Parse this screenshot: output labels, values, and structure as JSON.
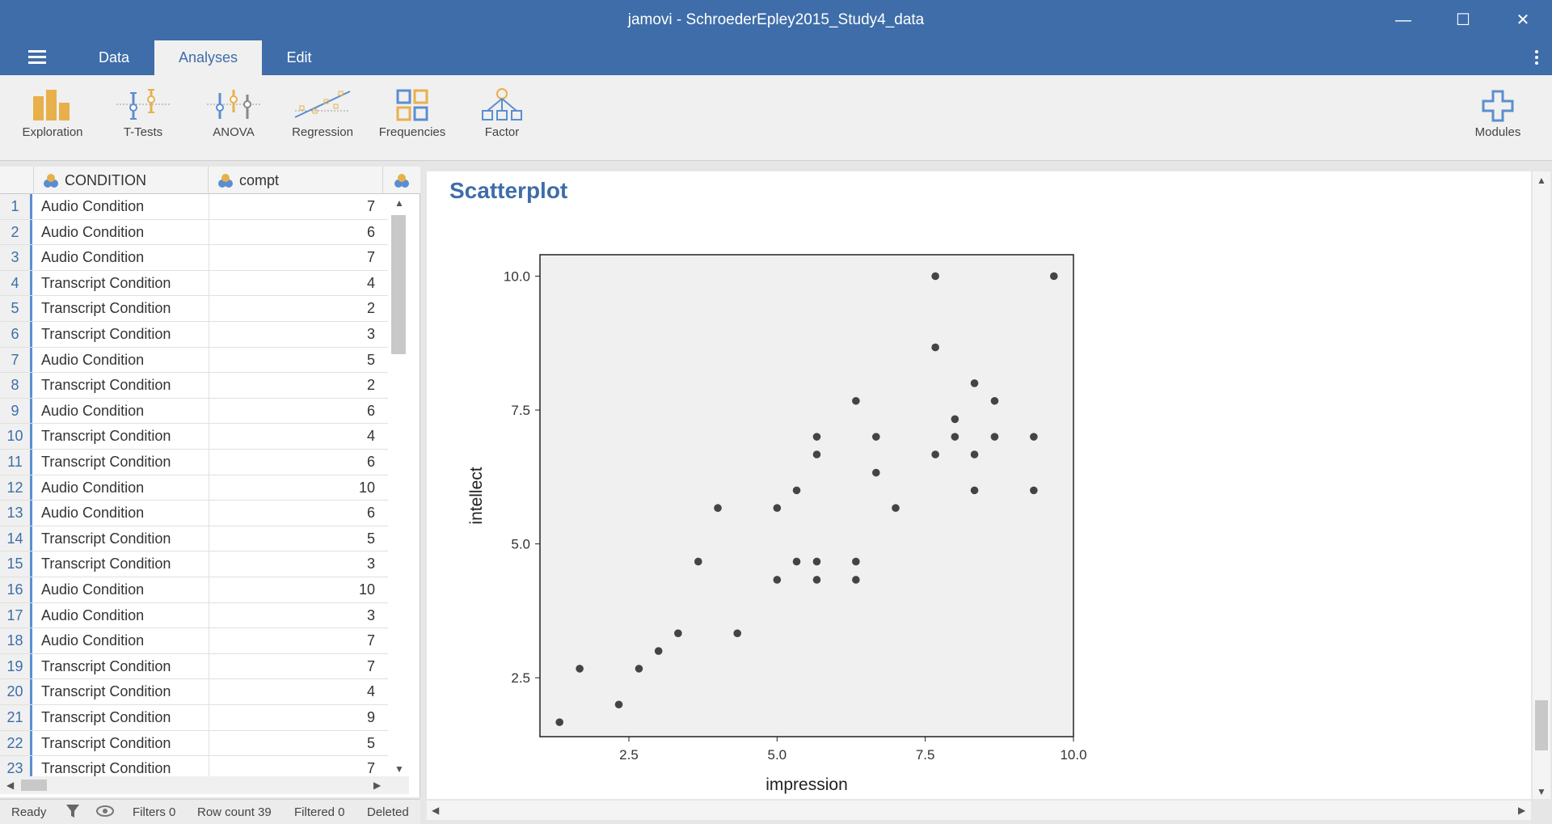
{
  "window": {
    "title": "jamovi - SchroederEpley2015_Study4_data",
    "minimize": "—",
    "maximize": "☐",
    "close": "✕"
  },
  "tabs": [
    {
      "label": "Data"
    },
    {
      "label": "Analyses"
    },
    {
      "label": "Edit"
    }
  ],
  "ribbon": [
    {
      "label": "Exploration",
      "icon": "exploration-icon"
    },
    {
      "label": "T-Tests",
      "icon": "ttests-icon"
    },
    {
      "label": "ANOVA",
      "icon": "anova-icon"
    },
    {
      "label": "Regression",
      "icon": "regression-icon"
    },
    {
      "label": "Frequencies",
      "icon": "frequencies-icon"
    },
    {
      "label": "Factor",
      "icon": "factor-icon"
    },
    {
      "label": "Modules",
      "icon": "modules-icon"
    }
  ],
  "datagrid": {
    "columns": [
      "CONDITION",
      "compt"
    ],
    "rows": [
      {
        "n": "1",
        "condition": "Audio Condition",
        "compt": "7"
      },
      {
        "n": "2",
        "condition": "Audio Condition",
        "compt": "6"
      },
      {
        "n": "3",
        "condition": "Audio Condition",
        "compt": "7"
      },
      {
        "n": "4",
        "condition": "Transcript Condition",
        "compt": "4"
      },
      {
        "n": "5",
        "condition": "Transcript Condition",
        "compt": "2"
      },
      {
        "n": "6",
        "condition": "Transcript Condition",
        "compt": "3"
      },
      {
        "n": "7",
        "condition": "Audio Condition",
        "compt": "5"
      },
      {
        "n": "8",
        "condition": "Transcript Condition",
        "compt": "2"
      },
      {
        "n": "9",
        "condition": "Audio Condition",
        "compt": "6"
      },
      {
        "n": "10",
        "condition": "Transcript Condition",
        "compt": "4"
      },
      {
        "n": "11",
        "condition": "Transcript Condition",
        "compt": "6"
      },
      {
        "n": "12",
        "condition": "Audio Condition",
        "compt": "10"
      },
      {
        "n": "13",
        "condition": "Audio Condition",
        "compt": "6"
      },
      {
        "n": "14",
        "condition": "Transcript Condition",
        "compt": "5"
      },
      {
        "n": "15",
        "condition": "Transcript Condition",
        "compt": "3"
      },
      {
        "n": "16",
        "condition": "Audio Condition",
        "compt": "10"
      },
      {
        "n": "17",
        "condition": "Audio Condition",
        "compt": "3"
      },
      {
        "n": "18",
        "condition": "Audio Condition",
        "compt": "7"
      },
      {
        "n": "19",
        "condition": "Transcript Condition",
        "compt": "7"
      },
      {
        "n": "20",
        "condition": "Transcript Condition",
        "compt": "4"
      },
      {
        "n": "21",
        "condition": "Transcript Condition",
        "compt": "9"
      },
      {
        "n": "22",
        "condition": "Transcript Condition",
        "compt": "5"
      },
      {
        "n": "23",
        "condition": "Transcript Condition",
        "compt": "7"
      }
    ]
  },
  "status": {
    "ready": "Ready",
    "filters": "Filters 0",
    "row_count": "Row count 39",
    "filtered": "Filtered 0",
    "deleted": "Deleted"
  },
  "results": {
    "title": "Scatterplot"
  },
  "colors": {
    "accent": "#3e6da9",
    "plot_bg": "#f0f0f0",
    "point": "#444444"
  },
  "chart_data": {
    "type": "scatter",
    "xlabel": "impression",
    "ylabel": "intellect",
    "xlim": [
      1.0,
      10.0
    ],
    "ylim": [
      1.4,
      10.4
    ],
    "xticks": [
      "2.5",
      "5.0",
      "7.5",
      "10.0"
    ],
    "yticks": [
      "2.5",
      "5.0",
      "7.5",
      "10.0"
    ],
    "grid": false,
    "points": [
      [
        1.33,
        1.67
      ],
      [
        1.67,
        2.67
      ],
      [
        2.33,
        2.0
      ],
      [
        2.67,
        2.67
      ],
      [
        3.0,
        3.0
      ],
      [
        3.33,
        3.33
      ],
      [
        3.67,
        4.67
      ],
      [
        4.0,
        5.67
      ],
      [
        4.33,
        3.33
      ],
      [
        5.0,
        4.33
      ],
      [
        5.0,
        5.67
      ],
      [
        5.33,
        4.67
      ],
      [
        5.33,
        6.0
      ],
      [
        5.67,
        4.33
      ],
      [
        5.67,
        4.67
      ],
      [
        5.67,
        6.67
      ],
      [
        5.67,
        7.0
      ],
      [
        6.33,
        4.33
      ],
      [
        6.33,
        4.67
      ],
      [
        6.33,
        7.67
      ],
      [
        6.67,
        6.33
      ],
      [
        6.67,
        7.0
      ],
      [
        7.0,
        5.67
      ],
      [
        7.67,
        6.67
      ],
      [
        7.67,
        8.67
      ],
      [
        7.67,
        10.0
      ],
      [
        8.0,
        7.0
      ],
      [
        8.0,
        7.33
      ],
      [
        8.33,
        6.0
      ],
      [
        8.33,
        6.67
      ],
      [
        8.33,
        8.0
      ],
      [
        8.67,
        7.0
      ],
      [
        8.67,
        7.67
      ],
      [
        9.33,
        6.0
      ],
      [
        9.33,
        7.0
      ],
      [
        9.67,
        10.0
      ]
    ]
  }
}
